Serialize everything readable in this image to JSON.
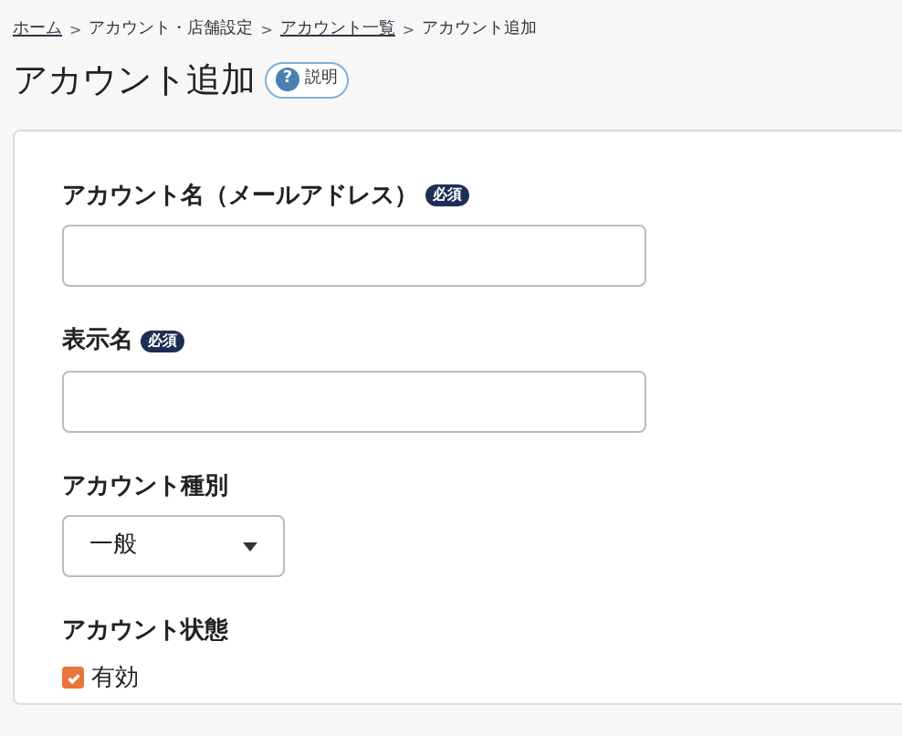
{
  "breadcrumb": [
    {
      "label": "ホーム",
      "link": true
    },
    {
      "label": "アカウント・店舗設定",
      "link": false
    },
    {
      "label": "アカウント一覧",
      "link": true
    },
    {
      "label": "アカウント追加",
      "link": false
    }
  ],
  "breadcrumb_separator": ">",
  "title": "アカウント追加",
  "help_button": {
    "icon": "?",
    "label": "説明"
  },
  "fields": [
    {
      "kind": "text",
      "label": "アカウント名（メールアドレス）",
      "required_badge": "必須"
    },
    {
      "kind": "text",
      "label": "表示名",
      "required_badge": "必須"
    },
    {
      "kind": "select",
      "label": "アカウント種別",
      "value": "一般"
    },
    {
      "kind": "checkbox",
      "label": "アカウント状態",
      "option": "有効",
      "checked": true
    }
  ]
}
